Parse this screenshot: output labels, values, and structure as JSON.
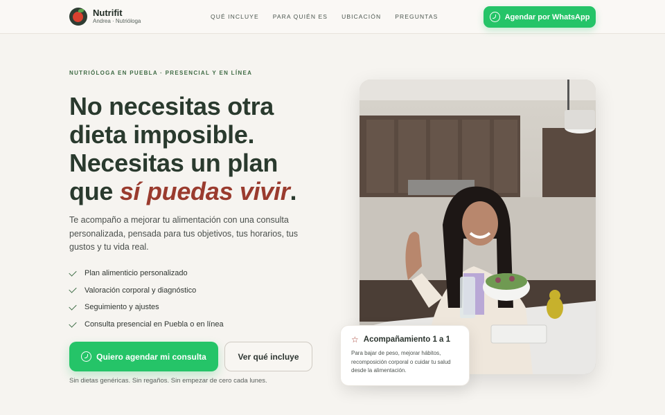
{
  "brand": {
    "name": "Nutrifit",
    "subtitle": "Andrea · Nutrióloga",
    "logo_icon": "fruit-logo-icon"
  },
  "nav": {
    "links": [
      "QUÉ INCLUYE",
      "PARA QUIÉN ES",
      "UBICACIÓN",
      "PREGUNTAS"
    ],
    "cta_label": "Agendar por WhatsApp",
    "cta_icon": "whatsapp-icon"
  },
  "hero": {
    "eyebrow": "NUTRIÓLOGA EN PUEBLA · PRESENCIAL Y EN LÍNEA",
    "headline": {
      "line1": "No necesitas otra",
      "line2": "dieta imposible.",
      "line3": "Necesitas un plan",
      "line4_prefix": "que ",
      "line4_accent": "sí puedas vivir",
      "line4_suffix": "."
    },
    "lead": "Te acompaño a mejorar tu alimentación con una consulta personalizada, pensada para tus objetivos, tus horarios, tus gustos y tu vida real.",
    "checklist": [
      "Plan alimenticio personalizado",
      "Valoración corporal y diagnóstico",
      "Seguimiento y ajustes",
      "Consulta presencial en Puebla o en línea"
    ],
    "primary_cta": "Quiero agendar mi consulta",
    "secondary_cta": "Ver qué incluye",
    "note": "Sin dietas genéricas. Sin regaños. Sin empezar de cero cada lunes."
  },
  "card": {
    "icon": "star-icon",
    "title": "Acompañamiento 1 a 1",
    "text": "Para bajar de peso, mejorar hábitos, recomposición corporal o cuidar tu salud desde la alimentación."
  },
  "colors": {
    "accent_green": "#25c468",
    "headline_dark": "#2a3a2e",
    "accent_red": "#9a3b2e",
    "background": "#f6f4f0"
  }
}
